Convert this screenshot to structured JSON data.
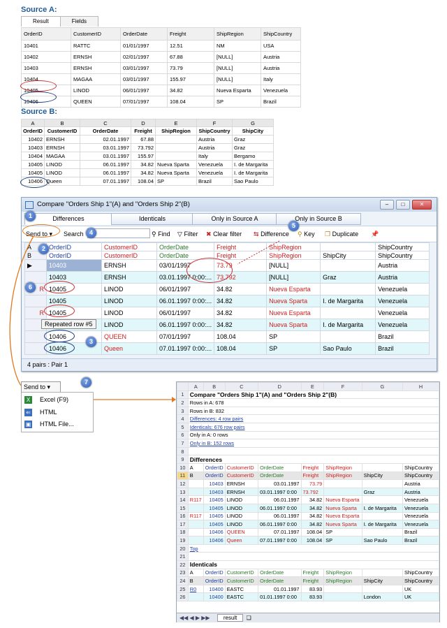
{
  "sourceA": {
    "label": "Source A:",
    "tabs": [
      "Result",
      "Fields"
    ],
    "columns": [
      "OrderID",
      "CustomerID",
      "OrderDate",
      "Freight",
      "ShipRegion",
      "ShipCountry"
    ],
    "rows": [
      [
        "10401",
        "RATTC",
        "01/01/1997",
        "12.51",
        "NM",
        "USA"
      ],
      [
        "10402",
        "ERNSH",
        "02/01/1997",
        "67.88",
        "[NULL]",
        "Austria"
      ],
      [
        "10403",
        "ERNSH",
        "03/01/1997",
        "73.79",
        "[NULL]",
        "Austria"
      ],
      [
        "10404",
        "MAGAA",
        "03/01/1997",
        "155.97",
        "[NULL]",
        "Italy"
      ],
      [
        "10405",
        "LINOD",
        "06/01/1997",
        "34.82",
        "Nueva Esparta",
        "Venezuela"
      ],
      [
        "10406",
        "QUEEN",
        "07/01/1997",
        "108.04",
        "SP",
        "Brazil"
      ]
    ]
  },
  "sourceB": {
    "label": "Source B:",
    "col_letters": [
      "A",
      "B",
      "C",
      "D",
      "E",
      "F",
      "G"
    ],
    "columns": [
      "OrderID",
      "CustomerID",
      "OrderDate",
      "Freight",
      "ShipRegion",
      "ShipCountry",
      "ShipCity"
    ],
    "rows": [
      [
        "10402",
        "ERNSH",
        "02.01.1997",
        "67.88",
        "",
        "Austria",
        "Graz"
      ],
      [
        "10403",
        "ERNSH",
        "03.01.1997",
        "73.792",
        "",
        "Austria",
        "Graz"
      ],
      [
        "10404",
        "MAGAA",
        "03.01.1997",
        "155.97",
        "",
        "Italy",
        "Bergamo"
      ],
      [
        "10405",
        "LINOD",
        "06.01.1997",
        "34.82",
        "Nueva Sparta",
        "Venezuela",
        "I. de Margarita"
      ],
      [
        "10405",
        "LINOD",
        "06.01.1997",
        "34.82",
        "Nueva Sparta",
        "Venezuela",
        "I. de Margarita"
      ],
      [
        "10406",
        "Queen",
        "07.01.1997",
        "108.04",
        "SP",
        "Brazil",
        "Sao Paulo"
      ]
    ]
  },
  "window": {
    "title": "Compare \"Orders Ship 1\"(A) and \"Orders Ship 2\"(B)",
    "tabs": [
      "Differences",
      "Identicals",
      "Only in Source A",
      "Only in Source B"
    ],
    "toolbar": {
      "send_to": "Send to",
      "search": "Search",
      "search_value": "",
      "find": "Find",
      "filter": "Filter",
      "clear_filter": "Clear filter",
      "difference": "Difference",
      "key": "Key",
      "duplicate": "Duplicate"
    },
    "grid_header": {
      "ab": [
        "A",
        "B"
      ],
      "cols": [
        [
          "OrderID",
          "OrderID"
        ],
        [
          "CustomerID",
          "CustomerID"
        ],
        [
          "OrderDate",
          "OrderDate"
        ],
        [
          "Freight",
          "Freight"
        ],
        [
          "ShipRegion",
          "ShipRegion"
        ],
        [
          "",
          "ShipCity"
        ],
        [
          "ShipCountry",
          "ShipCountry"
        ]
      ]
    },
    "grid_rows": [
      [
        "",
        "10403",
        "ERNSH",
        "03/01/1997",
        "73.79",
        "[NULL]",
        "",
        "Austria"
      ],
      [
        "",
        "10403",
        "ERNSH",
        "03.01.1997 0:00:...",
        "73.792",
        "[NULL]",
        "Graz",
        "Austria"
      ],
      [
        "R",
        "10405",
        "LINOD",
        "06/01/1997",
        "34.82",
        "Nueva Esparta",
        "",
        "Venezuela"
      ],
      [
        "",
        "10405",
        "LINOD",
        "06.01.1997 0:00:...",
        "34.82",
        "Nueva Sparta",
        "I. de Margarita",
        "Venezuela"
      ],
      [
        "R",
        "10405",
        "LINOD",
        "06/01/1997",
        "34.82",
        "Nueva Esparta",
        "",
        "Venezuela"
      ],
      [
        "",
        "10405",
        "LINOD",
        "06.01.1997 0:00:...",
        "34.82",
        "Nueva Sparta",
        "I. de Margarita",
        "Venezuela"
      ],
      [
        "",
        "10406",
        "QUEEN",
        "07/01/1997",
        "108.04",
        "SP",
        "",
        "Brazil"
      ],
      [
        "",
        "10406",
        "Queen",
        "07.01.1997 0:00:...",
        "108.04",
        "SP",
        "Sao Paulo",
        "Brazil"
      ]
    ],
    "tooltip": "Repeated row #5",
    "status": "4 pairs  : Pair 1"
  },
  "send_menu": {
    "button": "Send to",
    "items": [
      "Excel (F9)",
      "HTML",
      "HTML File..."
    ]
  },
  "badges": [
    "1",
    "2",
    "3",
    "4",
    "5",
    "6",
    "7"
  ],
  "excel": {
    "col_letters": [
      "A",
      "B",
      "C",
      "D",
      "E",
      "F",
      "G",
      "H"
    ],
    "title": "Compare \"Orders Ship 1\"(A) and \"Orders Ship 2\"(B)",
    "rows_a": "Rows in A: 678",
    "rows_b": "Rows in B: 832",
    "diff_link": "Differences: 4 row pairs",
    "ident_link": "Identicals: 676 row pairs",
    "only_a": "Only in A: 0 rows",
    "only_b": "Only in B: 152 rows",
    "diff_title": "Differences",
    "diff_head_a": [
      "A",
      "OrderID",
      "CustomerID",
      "OrderDate",
      "Freight",
      "ShipRegion",
      "",
      "ShipCountry"
    ],
    "diff_head_b": [
      "B",
      "OrderID",
      "CustomerID",
      "OrderDate",
      "Freight",
      "ShipRegion",
      "ShipCity",
      "ShipCountry"
    ],
    "diff_rows": [
      [
        "",
        "10403",
        "ERNSH",
        "03.01.1997",
        "73.79",
        "",
        "",
        "Austria"
      ],
      [
        "",
        "10403",
        "ERNSH",
        "03.01.1997 0:00",
        "73.792",
        "",
        "Graz",
        "Austria"
      ],
      [
        "R117",
        "10405",
        "LINOD",
        "06.01.1997",
        "34.82",
        "Nueva Esparta",
        "",
        "Venezuela"
      ],
      [
        "",
        "10405",
        "LINOD",
        "06.01.1997 0:00",
        "34.82",
        "Nueva Sparta",
        "I. de Margarita",
        "Venezuela"
      ],
      [
        "R117",
        "10405",
        "LINOD",
        "06.01.1997",
        "34.82",
        "Nueva Esparta",
        "",
        "Venezuela"
      ],
      [
        "",
        "10405",
        "LINOD",
        "06.01.1997 0:00",
        "34.82",
        "Nueva Sparta",
        "I. de Margarita",
        "Venezuela"
      ],
      [
        "",
        "10406",
        "QUEEN",
        "07.01.1997",
        "108.04",
        "SP",
        "",
        "Brazil"
      ],
      [
        "",
        "10406",
        "Queen",
        "07.01.1997 0:00",
        "108.04",
        "SP",
        "Sao Paulo",
        "Brazil"
      ]
    ],
    "top_link": "Top",
    "ident_title": "Identicals",
    "ident_head_a": [
      "A",
      "OrderID",
      "CustomerID",
      "OrderDate",
      "Freight",
      "ShipRegion",
      "",
      "ShipCountry"
    ],
    "ident_head_b": [
      "B",
      "OrderID",
      "CustomerID",
      "OrderDate",
      "Freight",
      "ShipRegion",
      "ShipCity",
      "ShipCountry"
    ],
    "ident_rows": [
      [
        "R0",
        "10400",
        "EASTC",
        "01.01.1997",
        "83.93",
        "",
        "",
        "UK"
      ],
      [
        "",
        "10400",
        "EASTC",
        "01.01.1997 0:00",
        "83.93",
        "",
        "London",
        "UK"
      ]
    ],
    "sheet_tab": "result"
  }
}
